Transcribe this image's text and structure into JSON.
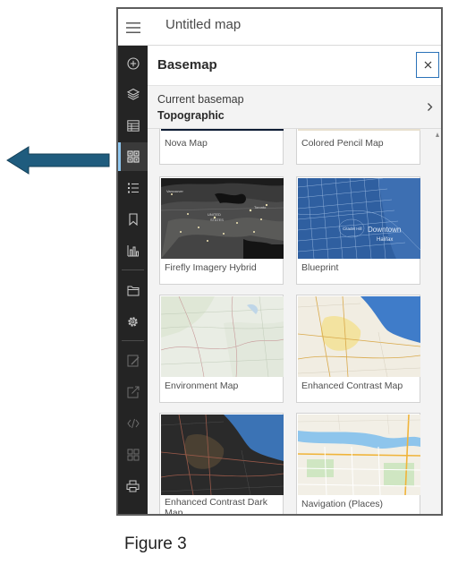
{
  "app": {
    "title": "Untitled map"
  },
  "action_rail": {
    "items": [
      {
        "name": "add-icon",
        "state": "normal"
      },
      {
        "name": "layers-icon",
        "state": "normal"
      },
      {
        "name": "table-icon",
        "state": "normal"
      },
      {
        "name": "basemap-gallery-icon",
        "state": "active"
      },
      {
        "name": "legend-icon",
        "state": "normal"
      },
      {
        "name": "bookmark-icon",
        "state": "normal"
      },
      {
        "name": "charts-icon",
        "state": "normal"
      },
      {
        "name": "folder-icon",
        "state": "normal"
      },
      {
        "name": "gear-icon",
        "state": "normal"
      },
      {
        "name": "edit-icon",
        "state": "disabled"
      },
      {
        "name": "share-icon",
        "state": "disabled"
      },
      {
        "name": "embed-icon",
        "state": "disabled"
      },
      {
        "name": "apps-icon",
        "state": "disabled"
      },
      {
        "name": "print-icon",
        "state": "normal"
      }
    ]
  },
  "panel": {
    "title": "Basemap",
    "current_basemap_label": "Current basemap",
    "current_basemap_value": "Topographic",
    "tiles": [
      {
        "label": "Nova Map"
      },
      {
        "label": "Colored Pencil Map"
      },
      {
        "label": "Firefly Imagery Hybrid"
      },
      {
        "label": "Blueprint"
      },
      {
        "label": "Environment Map"
      },
      {
        "label": "Enhanced Contrast Map"
      },
      {
        "label": "Enhanced Contrast Dark Map"
      },
      {
        "label": "Navigation (Places)"
      }
    ],
    "firefly_place_labels": {
      "a": "Vancouver",
      "b": "UNITED",
      "c": "STATES",
      "d": "Toronto"
    },
    "blueprint_place_labels": {
      "a": "Citadel Hill",
      "b": "Downtown",
      "c": "Halifax"
    }
  },
  "colors": {
    "rail": "#242424",
    "accent": "#2a72b8",
    "active_indicator": "#8fc7f0",
    "pointer_arrow": "#1f5c7e"
  },
  "figure": {
    "caption": "Figure 3"
  }
}
